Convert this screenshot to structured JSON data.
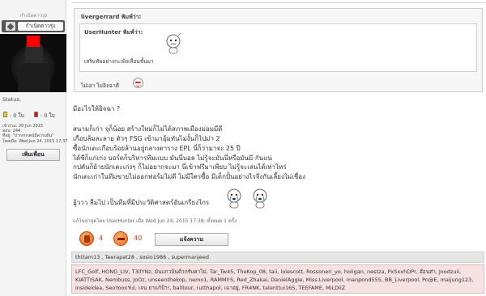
{
  "user": {
    "title": "กำเนิดดาวรุ่ง",
    "rank": "กำเนิดดาวรุ่ง",
    "status_label": "Status:",
    "yellow_cards": ": 0 ใบ",
    "red_cards": ": 0 ใบ",
    "joined": "เข้าร่วม: 20 Jun 2015",
    "posts": "ตอบ: 244",
    "location": "ที่อยู่: \"ปากกกกตบ์มีความฝัน\"",
    "last_seen": "โพสเมื่อ: Wed Jun 24, 2015 17:37",
    "add_friend": "เพิ่มเพื่อน"
  },
  "post": {
    "outer_quote": {
      "header": "livergerrard พิมพ์ว่า:",
      "text": "ไม่เอา ไม่อิจฉาดี"
    },
    "inner_quote": {
      "header": "UserHunter พิมพ์ว่า:",
      "text": "เสริมทัพอย่างกะเพิ่งเลื่อนชั้นมา"
    },
    "body": [
      "มีอะไรให้อิจฉา ?",
      "สนามก็เก่า จุก็น้อย สร้างใหม่ก็ไม่ได้สภาพเมืองม่อมมีดี",
      "เกือบล้มละลาย ตัวๆ FSG เข้ามาอุ้มทันไม่งั้นก็ไปม่า 2",
      "ซื้อนักเตะเกือบร้อยล้านอยู่กลางตาราง EPL นี่ก็ว่ามาจะ 25 ปี",
      "ได้ซีก็แก่เก่ง บอร์ดก็บริหารทีมแบบ มันนี่บอล ไม่รู้จะมันนี่หรือมันมี กันแน่",
      "กปตันก็ย้ายนักเตะเก่งๆ ก็ไม่อยากจะมา นี่เข้าฟรีมาเพียบ ไม่รู้จะเล่นได้เท่าไหร่",
      "นักเตะเก่าในทีมขายไม่ออกฟอร์มไม่ดี ไม่มีใครซื้อ มีเด็กปั้นอย่างไรจึงกันเลี้ยงไม่เชื่อง",
      "อู้ววว ลืมไป เป็นทีมที่มีประวัติศาสตร์อันเกรียงไกร"
    ],
    "edit_note": "แก้ไขล่าสุดโดย UserHunter เมื่อ Wed Jun 24, 2015 17:38, ทั้งหมด 1 ครั้ง"
  },
  "reactions": {
    "like_count": "4",
    "laugh_count": "40",
    "report_button": "แจ้งความ",
    "like_users": "thttam13 , Teerapat28 , sosio1986 , supermanjeed",
    "laugh_users": [
      "LFC_Golf, HONG_LIV, T3llYNz, มันแกวบ้นต้ากรับคาไม่, Tar_Tw45, TheKop_08, taii, lolescott, Rossoneri_yo, holigan, nestza, PxSxxhDPr, อ๊อนส่า, Joodzuii,",
      "KIATTISAK, Nembuss, JoOz, unseenthekop, nemo1, RAMMI!S, Red_Zhakai, DanielAggie, Miss.Liverpool, manpond555, BB_Liverpool, Po@E, maijung123,",
      "insideidea, SeoYoonYul, เจน ยาแก้ป้า!, balltour, rutthapol, เฉาอยู่, FR4NK, talenttui165, TEEFAME, MiLDiiZ"
    ]
  }
}
